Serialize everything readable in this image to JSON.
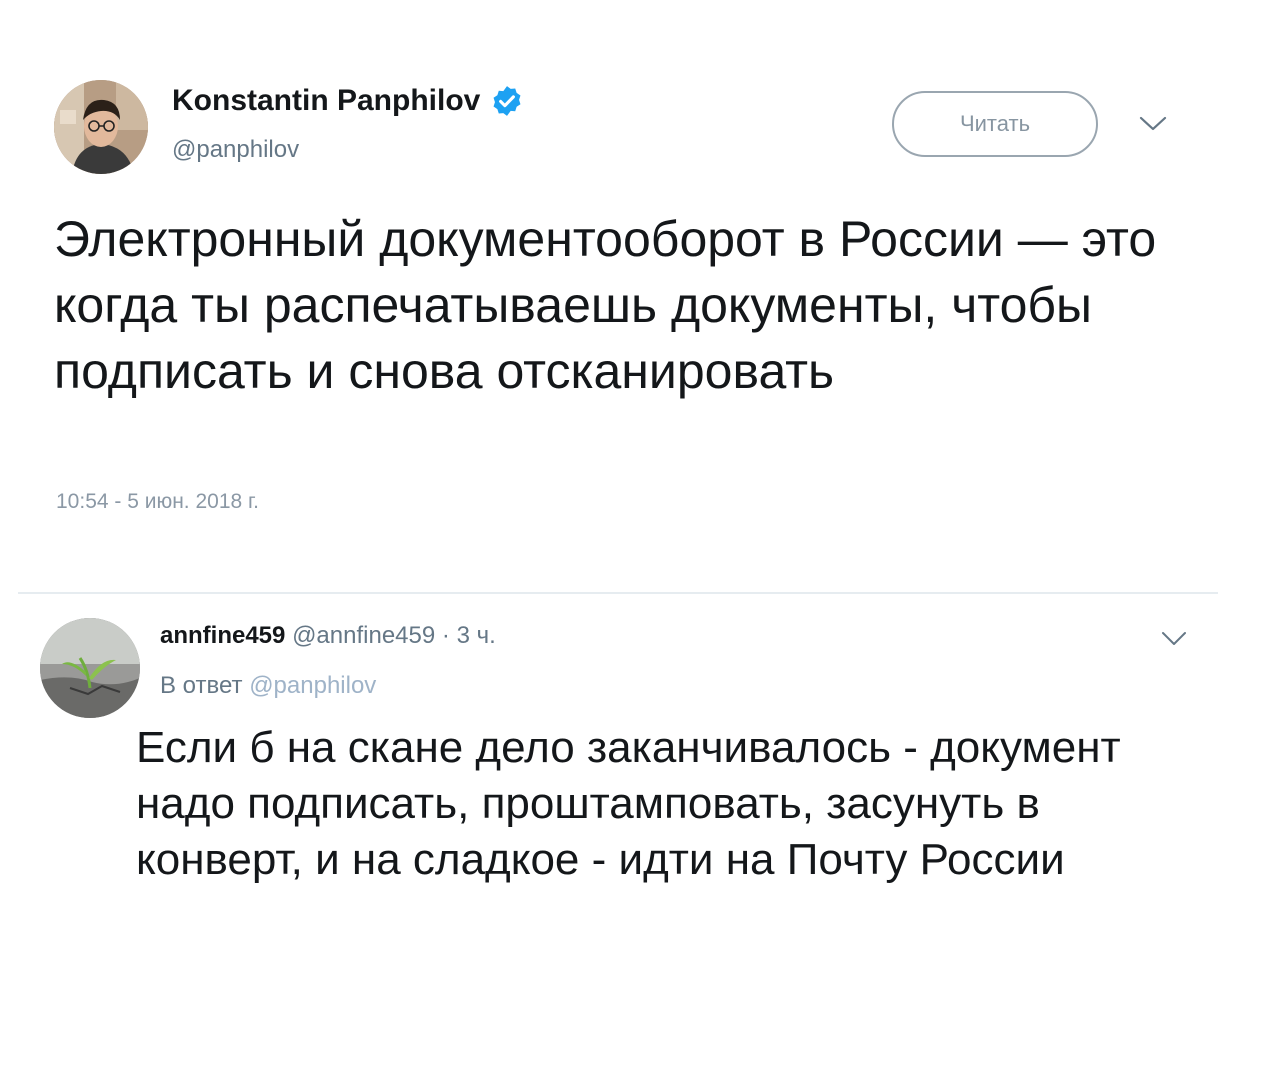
{
  "main_tweet": {
    "author_name": "Konstantin Panphilov",
    "handle": "@panphilov",
    "follow_label": "Читать",
    "text": "Электронный документооборот в России — это когда ты распечатываешь документы, чтобы подписать и снова отсканировать",
    "timestamp": "10:54 - 5 июн. 2018 г.",
    "verified_color": "#1da1f2"
  },
  "reply": {
    "author_name": "annfine459",
    "handle": "@annfine459",
    "separator": "·",
    "age": "3 ч.",
    "reply_prefix": "В ответ",
    "reply_to_handle": "@panphilov",
    "text": "Если б на скане дело заканчивалось - документ надо подписать, проштамповать, засунуть в конверт, и на сладкое - идти на Почту России"
  },
  "icons": {
    "verified": "verified-badge-icon",
    "more": "chevron-down-icon"
  }
}
